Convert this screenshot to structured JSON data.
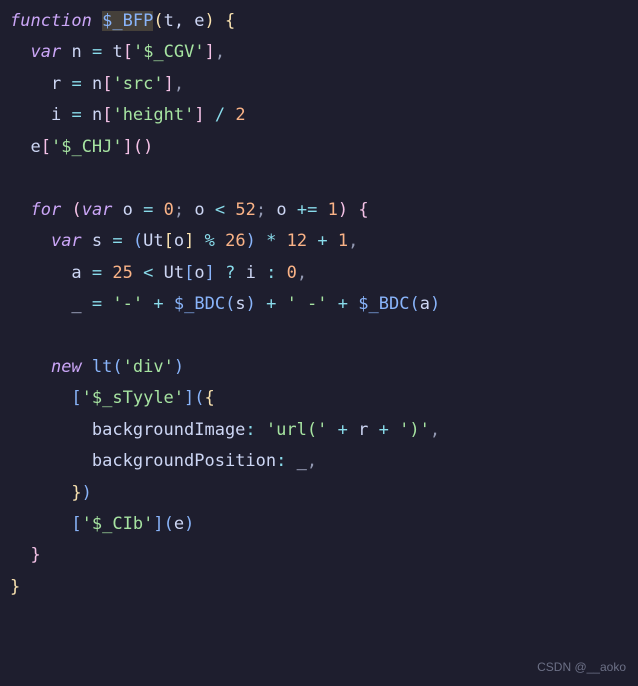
{
  "code": {
    "l1_kw": "function",
    "l1_fn": "$_BFP",
    "l1_params": "t, e",
    "l2_kw": "var",
    "l2_id": "n",
    "l2_op": "=",
    "l2_src": "t",
    "l2_str": "'$_CGV'",
    "l3_id": "r",
    "l3_op": "=",
    "l3_src": "n",
    "l3_str": "'src'",
    "l4_id": "i",
    "l4_op": "=",
    "l4_src": "n",
    "l4_str": "'height'",
    "l4_div": "/",
    "l4_num": "2",
    "l5_src": "e",
    "l5_str": "'$_CHJ'",
    "l7_kw": "for",
    "l7_var": "var",
    "l7_id": "o",
    "l7_eq": "=",
    "l7_zero": "0",
    "l7_lt": "<",
    "l7_lim": "52",
    "l7_pe": "+=",
    "l7_one": "1",
    "l8_kw": "var",
    "l8_id": "s",
    "l8_eq": "=",
    "l8_ut": "Ut",
    "l8_o": "o",
    "l8_mod": "%",
    "l8_26": "26",
    "l8_mul": "*",
    "l8_12": "12",
    "l8_plus": "+",
    "l8_1": "1",
    "l9_id": "a",
    "l9_eq": "=",
    "l9_25": "25",
    "l9_lt": "<",
    "l9_ut": "Ut",
    "l9_o": "o",
    "l9_q": "?",
    "l9_i": "i",
    "l9_colon": ":",
    "l9_0": "0",
    "l10_id": "_",
    "l10_eq": "=",
    "l10_s1": "'-'",
    "l10_plus": "+",
    "l10_fn": "$_BDC",
    "l10_s": "s",
    "l10_s2": "' -'",
    "l10_a": "a",
    "l12_kw": "new",
    "l12_fn": "lt",
    "l12_str": "'div'",
    "l13_str": "'$_sTyyle'",
    "l14_prop": "backgroundImage",
    "l14_s1": "'url('",
    "l14_plus": "+",
    "l14_r": "r",
    "l14_s2": "')'",
    "l15_prop": "backgroundPosition",
    "l15_v": "_",
    "l17_str": "'$_CIb'",
    "l17_e": "e"
  },
  "watermark": "CSDN @__aoko"
}
